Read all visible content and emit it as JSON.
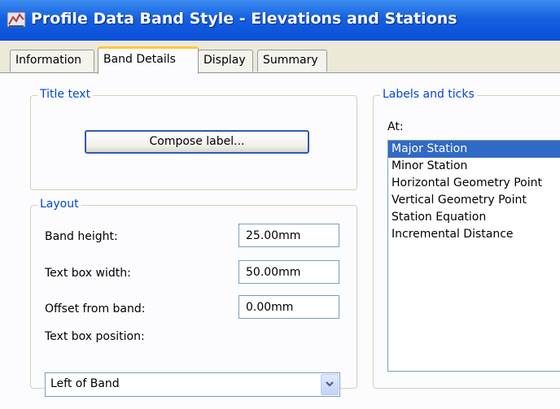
{
  "window": {
    "title": "Profile Data Band Style - Elevations and Stations",
    "icon": "app-icon"
  },
  "tabs": [
    {
      "label": "Information",
      "active": false
    },
    {
      "label": "Band Details",
      "active": true
    },
    {
      "label": "Display",
      "active": false
    },
    {
      "label": "Summary",
      "active": false
    }
  ],
  "title_text": {
    "legend": "Title text",
    "compose_button": "Compose label..."
  },
  "layout": {
    "legend": "Layout",
    "band_height_label": "Band height:",
    "band_height_value": "25.00mm",
    "text_box_width_label": "Text box width:",
    "text_box_width_value": "50.00mm",
    "offset_label": "Offset from band:",
    "offset_value": "0.00mm",
    "position_label": "Text box position:",
    "position_value": "Left of Band"
  },
  "labels_ticks": {
    "legend": "Labels and ticks",
    "at_label": "At:",
    "items": [
      {
        "label": "Major Station",
        "selected": true
      },
      {
        "label": "Minor Station",
        "selected": false
      },
      {
        "label": "Horizontal Geometry Point",
        "selected": false
      },
      {
        "label": "Vertical Geometry Point",
        "selected": false
      },
      {
        "label": "Station Equation",
        "selected": false
      },
      {
        "label": "Incremental Distance",
        "selected": false
      }
    ]
  },
  "colors": {
    "titlebar": "#0a4ed8",
    "legend_text": "#0046d5",
    "selection": "#316ac5",
    "active_tab_accent": "#ffc83c"
  }
}
